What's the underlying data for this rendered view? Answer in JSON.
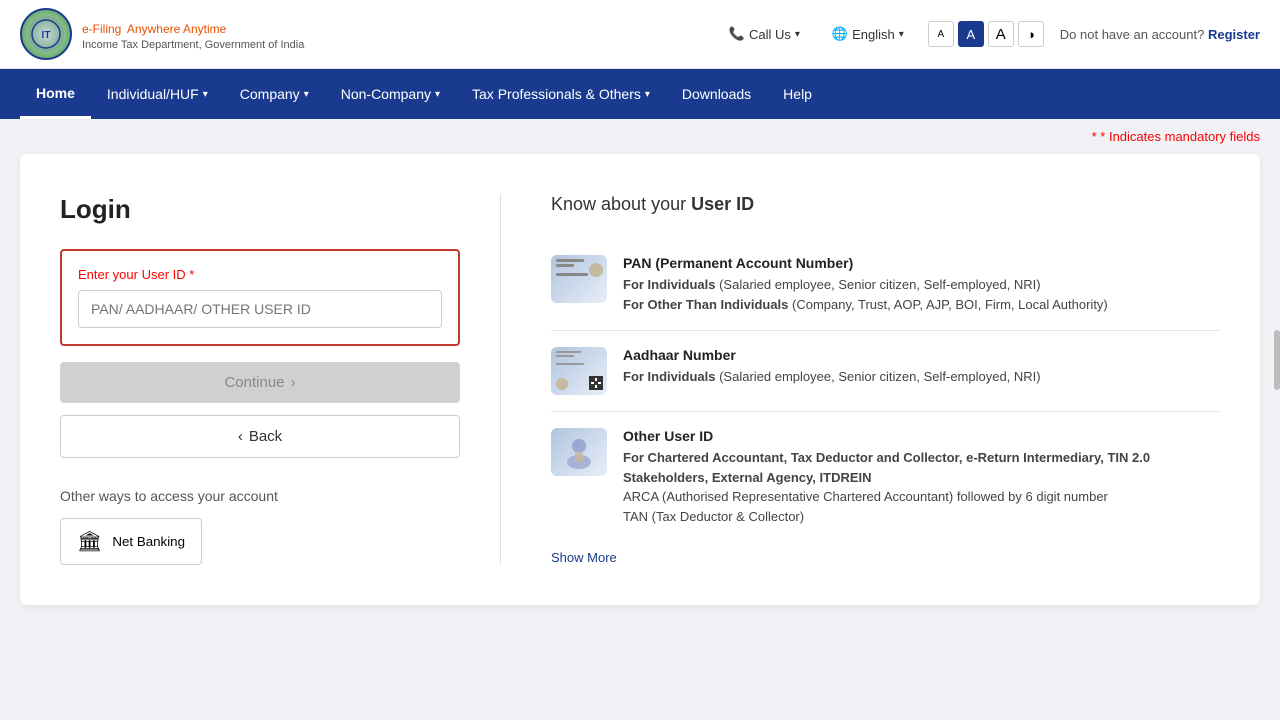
{
  "topBar": {
    "callUs": "Call Us",
    "language": "English",
    "fontSmall": "A",
    "fontMedium": "A",
    "fontLarge": "A",
    "noAccount": "Do not have an account?",
    "register": "Register"
  },
  "logo": {
    "efiling": "e-Filing",
    "tagline": "Anywhere Anytime",
    "subtitle": "Income Tax Department, Government of India"
  },
  "nav": {
    "items": [
      {
        "label": "Home",
        "active": true,
        "hasDropdown": false
      },
      {
        "label": "Individual/HUF",
        "active": false,
        "hasDropdown": true
      },
      {
        "label": "Company",
        "active": false,
        "hasDropdown": true
      },
      {
        "label": "Non-Company",
        "active": false,
        "hasDropdown": true
      },
      {
        "label": "Tax Professionals & Others",
        "active": false,
        "hasDropdown": true
      },
      {
        "label": "Downloads",
        "active": false,
        "hasDropdown": false
      },
      {
        "label": "Help",
        "active": false,
        "hasDropdown": false
      }
    ]
  },
  "mandatory": {
    "note": "* Indicates mandatory fields",
    "star": "*"
  },
  "login": {
    "title": "Login",
    "fieldLabel": "Enter your User ID",
    "required": "*",
    "placeholder": "PAN/ AADHAAR/ OTHER USER ID",
    "continueBtn": "Continue",
    "backBtn": "Back",
    "otherWaysTitle": "Other ways to access your account",
    "netBanking": "Net Banking"
  },
  "userIdInfo": {
    "title": "Know about your",
    "titleBold": "User ID",
    "items": [
      {
        "id": "pan",
        "heading": "PAN (Permanent Account Number)",
        "line1Bold": "For Individuals",
        "line1": " (Salaried employee, Senior citizen, Self-employed, NRI)",
        "line2Bold": "For Other Than Individuals",
        "line2": " (Company, Trust, AOP, AJP, BOI, Firm, Local Authority)"
      },
      {
        "id": "aadhaar",
        "heading": "Aadhaar Number",
        "line1Bold": "For Individuals",
        "line1": " (Salaried employee, Senior citizen, Self-employed, NRI)"
      },
      {
        "id": "other",
        "heading": "Other User ID",
        "line1Bold": "For Chartered Accountant, Tax Deductor and Collector, e-Return Intermediary, TIN 2.0 Stakeholders, External Agency, ITDREIN",
        "line2": "ARCA (Authorised Representative Chartered Accountant) followed by 6 digit number",
        "line3": "TAN (Tax Deductor & Collector)"
      }
    ],
    "showMore": "Show More"
  }
}
